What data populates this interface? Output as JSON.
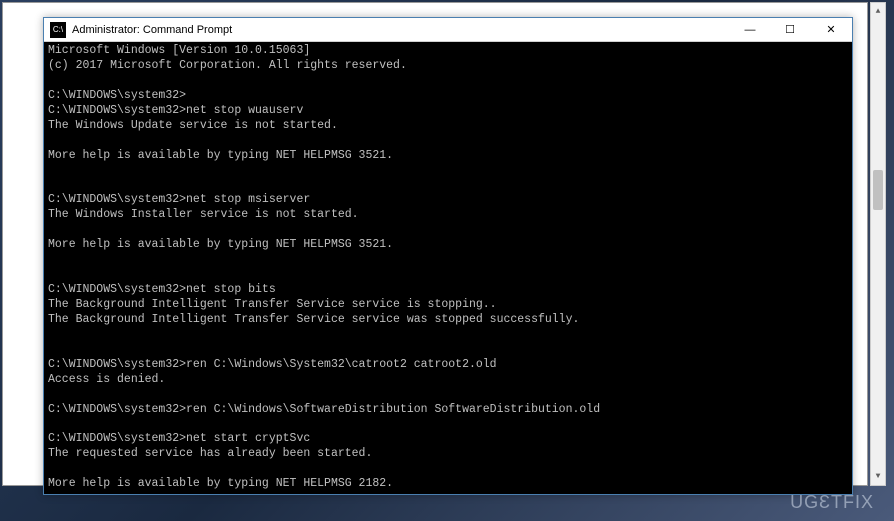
{
  "window": {
    "title": "Administrator: Command Prompt",
    "icon_label": "C:\\"
  },
  "controls": {
    "minimize": "—",
    "maximize": "☐",
    "close": "✕"
  },
  "terminal": {
    "lines": [
      "Microsoft Windows [Version 10.0.15063]",
      "(c) 2017 Microsoft Corporation. All rights reserved.",
      "",
      "C:\\WINDOWS\\system32>",
      "C:\\WINDOWS\\system32>net stop wuauserv",
      "The Windows Update service is not started.",
      "",
      "More help is available by typing NET HELPMSG 3521.",
      "",
      "",
      "C:\\WINDOWS\\system32>net stop msiserver",
      "The Windows Installer service is not started.",
      "",
      "More help is available by typing NET HELPMSG 3521.",
      "",
      "",
      "C:\\WINDOWS\\system32>net stop bits",
      "The Background Intelligent Transfer Service service is stopping..",
      "The Background Intelligent Transfer Service service was stopped successfully.",
      "",
      "",
      "C:\\WINDOWS\\system32>ren C:\\Windows\\System32\\catroot2 catroot2.old",
      "Access is denied.",
      "",
      "C:\\WINDOWS\\system32>ren C:\\Windows\\SoftwareDistribution SoftwareDistribution.old",
      "",
      "C:\\WINDOWS\\system32>net start cryptSvc",
      "The requested service has already been started.",
      "",
      "More help is available by typing NET HELPMSG 2182."
    ]
  },
  "watermark": {
    "text": "UGETFIX"
  }
}
